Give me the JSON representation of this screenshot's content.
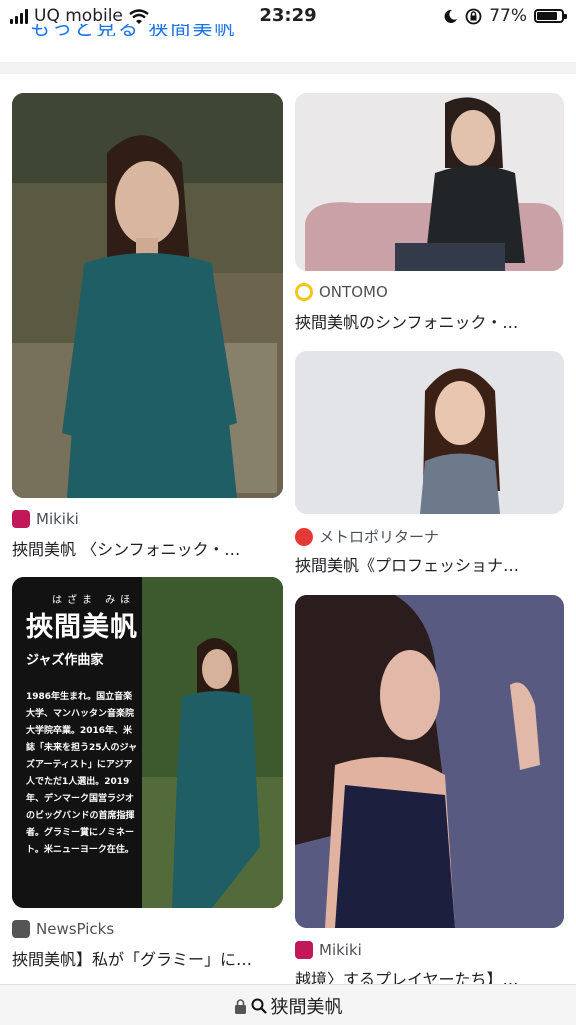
{
  "status_bar": {
    "carrier": "UQ mobile",
    "time": "23:29",
    "battery": "77%"
  },
  "header_cutoff_text": "もっと見る 狭間美帆",
  "results": [
    {
      "source": "Mikiki",
      "title": "挾間美帆 〈シンフォニック・…",
      "favicon_color": "#c2185b",
      "favicon_letter": "M"
    },
    {
      "source": "ONTOMO",
      "title": "挾間美帆のシンフォニック・…",
      "favicon_color": "#f5c518",
      "favicon_letter": "∞"
    },
    {
      "source": "メトロポリターナ",
      "title": "挾間美帆《プロフェッショナ…",
      "favicon_color": "#e53935",
      "favicon_letter": "m"
    },
    {
      "source": "NewsPicks",
      "title": "挾間美帆】私が「グラミー」に…",
      "favicon_color": "#555555",
      "favicon_letter": "N"
    },
    {
      "source": "Mikiki",
      "title": "越境〉するプレイヤーたち】…",
      "favicon_color": "#c2185b",
      "favicon_letter": "M"
    }
  ],
  "poster": {
    "ruby": "はざま みほ",
    "name": "挾間美帆",
    "role": "ジャズ作曲家",
    "bio": "1986年生まれ。国立音楽大学、マンハッタン音楽院大学院卒業。2016年、米誌「未来を担う25人のジャズアーティスト」にアジア人でただ1人選出。2019年、デンマーク国営ラジオのビッグバンドの首席指揮者。グラミー賞にノミネート。米ニューヨーク在住。"
  },
  "url_bar": {
    "query": "狭間美帆"
  }
}
